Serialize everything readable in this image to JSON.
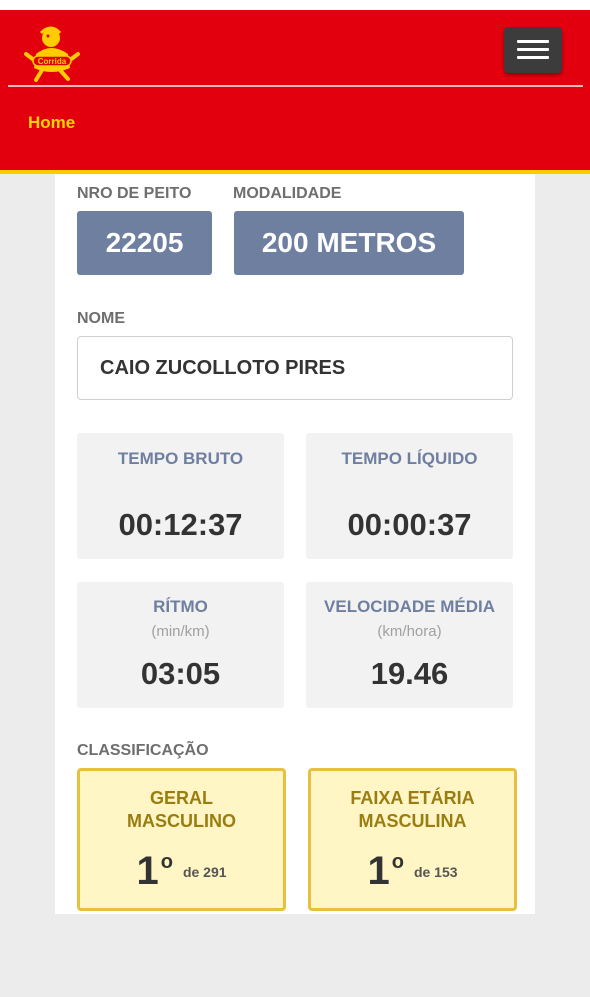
{
  "header": {
    "logo_icon": "mascot-logo-icon",
    "logo_text": "Corrida",
    "menu_icon": "hamburger-menu-icon",
    "nav_home": "Home"
  },
  "runner": {
    "bib_label": "NRO DE PEITO",
    "bib_value": "22205",
    "modality_label": "MODALIDADE",
    "modality_value": "200 METROS",
    "name_label": "NOME",
    "name_value": "CAIO ZUCOLLOTO PIRES"
  },
  "stats": {
    "gross_time": {
      "label": "TEMPO BRUTO",
      "value": "00:12:37"
    },
    "net_time": {
      "label": "TEMPO LÍQUIDO",
      "value": "00:00:37"
    },
    "pace": {
      "label": "RÍTMO",
      "unit": "(min/km)",
      "value": "03:05"
    },
    "avg_speed": {
      "label": "VELOCIDADE MÉDIA",
      "unit": "(km/hora)",
      "value": "19.46"
    }
  },
  "classification": {
    "label": "CLASSIFICAÇÃO",
    "overall": {
      "title_line1": "GERAL",
      "title_line2": "MASCULINO",
      "position": "1",
      "ordinal": "o",
      "total": "de 291"
    },
    "age_group": {
      "title_line1": "FAIXA ETÁRIA",
      "title_line2": "MASCULINA",
      "position": "1",
      "ordinal": "o",
      "total": "de 153"
    }
  },
  "colors": {
    "header_red": "#e2000f",
    "accent_yellow": "#ffcc00",
    "pill_blue": "#6f7fa0",
    "rank_bg": "#fff5c5",
    "rank_border": "#e8c040"
  }
}
